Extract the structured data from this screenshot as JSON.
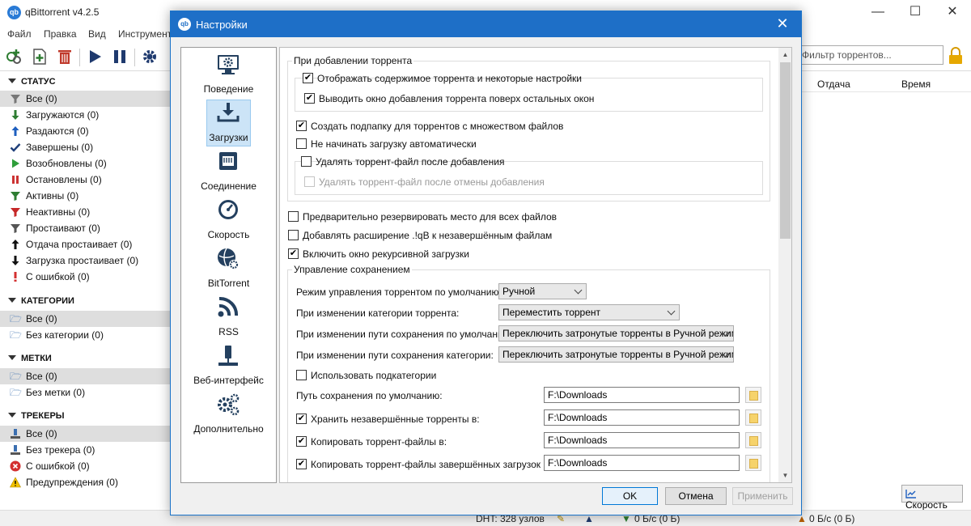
{
  "main_window": {
    "title": "qBittorrent v4.2.5",
    "app_icon": "qb",
    "menu": [
      "Файл",
      "Правка",
      "Вид",
      "Инструмент"
    ],
    "filter_placeholder": "Фильтр торрентов...",
    "columns": [
      "Отдача",
      "Время"
    ],
    "speed_button": "Скорость",
    "status": {
      "dht": "DHT: 328 узлов",
      "down": "0 Б/с (0 Б)",
      "up": "0 Б/с (0 Б)"
    }
  },
  "sidebar": {
    "status_header": "СТАТУС",
    "status_items": [
      {
        "label": "Все (0)",
        "icon": "filter-icon",
        "color": "#777777"
      },
      {
        "label": "Загружаются (0)",
        "icon": "arrow-down-icon",
        "color": "#2e7d32"
      },
      {
        "label": "Раздаются (0)",
        "icon": "arrow-up-icon",
        "color": "#1e5fbf"
      },
      {
        "label": "Завершены (0)",
        "icon": "check-icon",
        "color": "#1f3f7a"
      },
      {
        "label": "Возобновлены (0)",
        "icon": "play-icon",
        "color": "#2e9e3a"
      },
      {
        "label": "Остановлены (0)",
        "icon": "stop-icon",
        "color": "#cc3333"
      },
      {
        "label": "Активны (0)",
        "icon": "filter-icon",
        "color": "#2e7d32"
      },
      {
        "label": "Неактивны (0)",
        "icon": "filter-icon",
        "color": "#c62828"
      },
      {
        "label": "Простаивают (0)",
        "icon": "filter-icon",
        "color": "#555555"
      },
      {
        "label": "Отдача простаивает (0)",
        "icon": "arrow-up-icon",
        "color": "#111111"
      },
      {
        "label": "Загрузка простаивает (0)",
        "icon": "arrow-down-icon",
        "color": "#111111"
      },
      {
        "label": "С ошибкой (0)",
        "icon": "exclamation-icon",
        "color": "#d32f2f"
      }
    ],
    "categories_header": "КАТЕГОРИИ",
    "category_items": [
      {
        "label": "Все (0)"
      },
      {
        "label": "Без категории (0)"
      }
    ],
    "tags_header": "МЕТКИ",
    "tag_items": [
      {
        "label": "Все (0)"
      },
      {
        "label": "Без метки (0)"
      }
    ],
    "trackers_header": "ТРЕКЕРЫ",
    "tracker_items": [
      {
        "label": "Все (0)"
      },
      {
        "label": "Без трекера (0)"
      },
      {
        "label": "С ошибкой (0)"
      },
      {
        "label": "Предупреждения (0)"
      }
    ]
  },
  "dialog": {
    "title": "Настройки",
    "icon": "qb",
    "categories": [
      {
        "label": "Поведение",
        "icon": "monitor-gear-icon"
      },
      {
        "label": "Загрузки",
        "icon": "download-tray-icon"
      },
      {
        "label": "Соединение",
        "icon": "network-icon"
      },
      {
        "label": "Скорость",
        "icon": "speedometer-icon"
      },
      {
        "label": "BitTorrent",
        "icon": "globe-gear-icon"
      },
      {
        "label": "RSS",
        "icon": "rss-icon"
      },
      {
        "label": "Веб-интерфейс",
        "icon": "web-ui-icon"
      },
      {
        "label": "Дополнительно",
        "icon": "gears-icon"
      }
    ],
    "selected_category": "Загрузки",
    "add_group": {
      "title": "При добавлении торрента",
      "show_content": {
        "label": "Отображать содержимое торрента и некоторые настройки",
        "checked": true
      },
      "bring_to_top": {
        "label": "Выводить окно добавления торрента поверх остальных окон",
        "checked": true
      },
      "create_subfolder": {
        "label": "Создать подпапку для торрентов с множеством файлов",
        "checked": true
      },
      "dont_start": {
        "label": "Не начинать загрузку автоматически",
        "checked": false
      },
      "delete_after_add": {
        "label": "Удалять торрент-файл после добавления",
        "checked": false
      },
      "delete_after_cancel": {
        "label": "Удалять торрент-файл после отмены добавления",
        "checked": false
      }
    },
    "preallocate": {
      "label": "Предварительно резервировать место для всех файлов",
      "checked": false
    },
    "append_ext": {
      "label": "Добавлять расширение .!qB к незавершённым файлам",
      "checked": false
    },
    "recursive": {
      "label": "Включить окно рекурсивной загрузки",
      "checked": true
    },
    "save_group": {
      "title": "Управление сохранением",
      "mode_label": "Режим управления торрентом по умолчанию:",
      "mode_value": "Ручной",
      "cat_change_label": "При изменении категории торрента:",
      "cat_change_value": "Переместить торрент",
      "default_path_change_label": "При изменении пути сохранения по умолчанию:",
      "default_path_change_value": "Переключить затронутые торренты в Ручной режим",
      "cat_path_change_label": "При изменении пути сохранения категории:",
      "cat_path_change_value": "Переключить затронутые торренты в Ручной режим",
      "subcategories": {
        "label": "Использовать подкатегории",
        "checked": false
      },
      "default_path_label": "Путь сохранения по умолчанию:",
      "default_path": "F:\\Downloads",
      "incomplete": {
        "label": "Хранить незавершённые торренты в:",
        "checked": true,
        "path": "F:\\Downloads"
      },
      "copy_torrents": {
        "label": "Копировать торрент-файлы в:",
        "checked": true,
        "path": "F:\\Downloads"
      },
      "copy_finished": {
        "label": "Копировать торрент-файлы завершённых загрузок в:",
        "checked": true,
        "path": "F:\\Downloads"
      }
    },
    "buttons": {
      "ok": "OK",
      "cancel": "Отмена",
      "apply": "Применить"
    }
  },
  "check_mark": "✔"
}
